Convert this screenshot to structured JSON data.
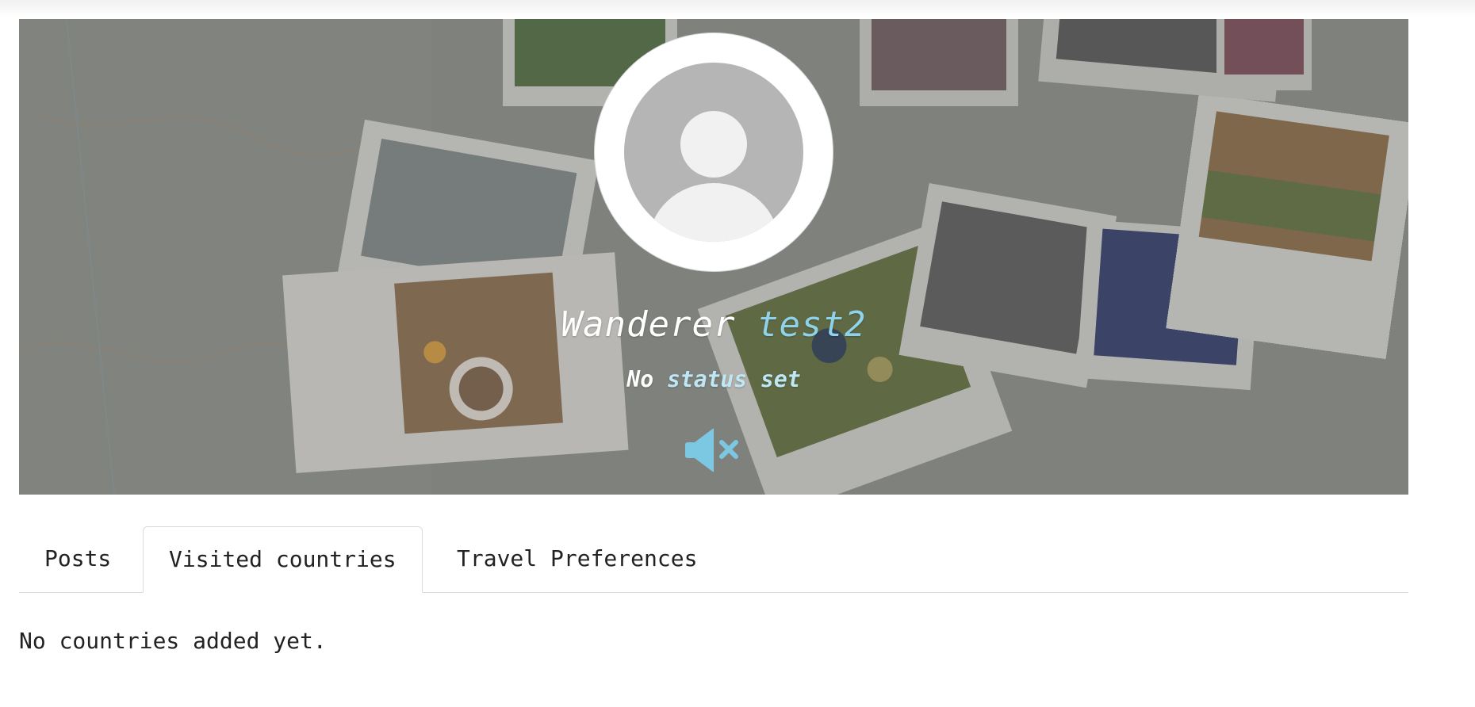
{
  "profile": {
    "first_name": "Wanderer",
    "last_name": "test2",
    "status_prefix": "No",
    "status_rest": "status set"
  },
  "icons": {
    "avatar": "user-placeholder-icon",
    "mute": "speaker-muted-icon"
  },
  "tabs": [
    {
      "label": "Posts",
      "active": false
    },
    {
      "label": "Visited countries",
      "active": true
    },
    {
      "label": "Travel Preferences",
      "active": false
    }
  ],
  "content": {
    "empty_message": "No countries added yet."
  },
  "colors": {
    "accent": "#8fd3ea",
    "mute_icon": "#7cc8e3"
  }
}
